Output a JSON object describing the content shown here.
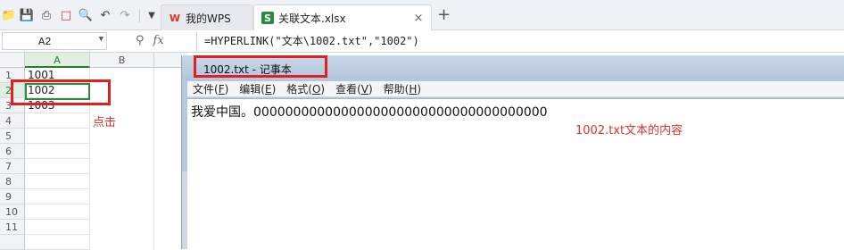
{
  "toolbar": {
    "icons": [
      "folder-icon",
      "save-icon",
      "print-icon",
      "pdf-icon",
      "print-preview-icon",
      "undo-icon",
      "redo-icon",
      "dropdown-icon"
    ]
  },
  "tabs": [
    {
      "label": "我的WPS",
      "icon": "wps-icon",
      "active": false
    },
    {
      "label": "关联文本.xlsx",
      "icon": "spreadsheet-icon",
      "active": true
    }
  ],
  "tabs_add_label": "+",
  "tab_close_label": "×",
  "formula_bar": {
    "name_box": "A2",
    "formula": "=HYPERLINK(\"文本\\1002.txt\",\"1002\")",
    "fx_label": "fx"
  },
  "sheet": {
    "columns": [
      "A",
      "B"
    ],
    "rows": [
      "1",
      "2",
      "3",
      "4",
      "5",
      "6",
      "7",
      "8",
      "9",
      "10",
      "11"
    ],
    "cells": {
      "A1": "1001",
      "A2": "1002",
      "A3": "1003"
    },
    "selected_cell": "A2"
  },
  "annotations": {
    "click_note": "点击",
    "content_note": "1002.txt文本的内容",
    "highlight_color": "#e02020"
  },
  "notepad": {
    "title": "1002.txt - 记事本",
    "menu": [
      {
        "label": "文件(",
        "key": "F",
        "tail": ")"
      },
      {
        "label": "编辑(",
        "key": "E",
        "tail": ")"
      },
      {
        "label": "格式(",
        "key": "O",
        "tail": ")"
      },
      {
        "label": "查看(",
        "key": "V",
        "tail": ")"
      },
      {
        "label": "帮助(",
        "key": "H",
        "tail": ")"
      }
    ],
    "content": "我爱中国。0000000000000000000000000000000000000"
  }
}
